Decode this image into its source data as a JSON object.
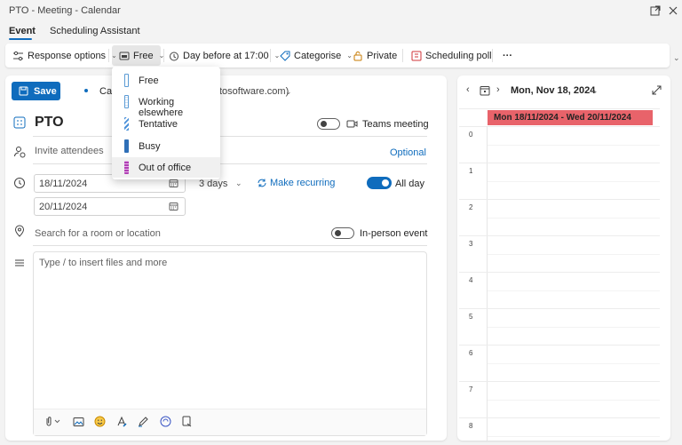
{
  "window": {
    "title": "PTO - Meeting - Calendar"
  },
  "tabs": [
    {
      "label": "Event",
      "active": true
    },
    {
      "label": "Scheduling Assistant",
      "active": false
    }
  ],
  "toolbar": {
    "response_options": "Response options",
    "show_as": "Free",
    "reminder": "Day before at 17:00",
    "categorise": "Categorise",
    "private": "Private",
    "scheduling_poll": "Scheduling poll",
    "more": "···"
  },
  "form": {
    "save_label": "Save",
    "calendar_label": "Cal",
    "calendar_account": "tosoftware.com)",
    "title": "PTO",
    "teams_meeting": "Teams meeting",
    "invite_placeholder": "Invite attendees",
    "optional": "Optional",
    "start_date": "18/11/2024",
    "end_date": "20/11/2024",
    "duration": "3 days",
    "make_recurring": "Make recurring",
    "all_day": "All day",
    "location_placeholder": "Search for a room or location",
    "in_person": "In-person event",
    "body_placeholder": "Type / to insert files and more"
  },
  "show_as_dropdown": {
    "items": [
      {
        "label": "Free",
        "color": "#5b9bd5",
        "selected": false
      },
      {
        "label": "Working elsewhere",
        "color": "#5b9bd5",
        "selected": false
      },
      {
        "label": "Tentative",
        "color": "#4a90d9",
        "selected": false
      },
      {
        "label": "Busy",
        "color": "#2f6fb7",
        "selected": false
      },
      {
        "label": "Out of office",
        "color": "#b03fb4",
        "selected": true
      }
    ]
  },
  "calendar_panel": {
    "date_label": "Mon, Nov 18, 2024",
    "event_label": "Mon 18/11/2024 - Wed 20/11/2024",
    "event_color": "#e8636a",
    "hours": [
      "0",
      "1",
      "2",
      "3",
      "4",
      "5",
      "6",
      "7",
      "8"
    ]
  },
  "colors": {
    "accent": "#0f6cbd"
  }
}
